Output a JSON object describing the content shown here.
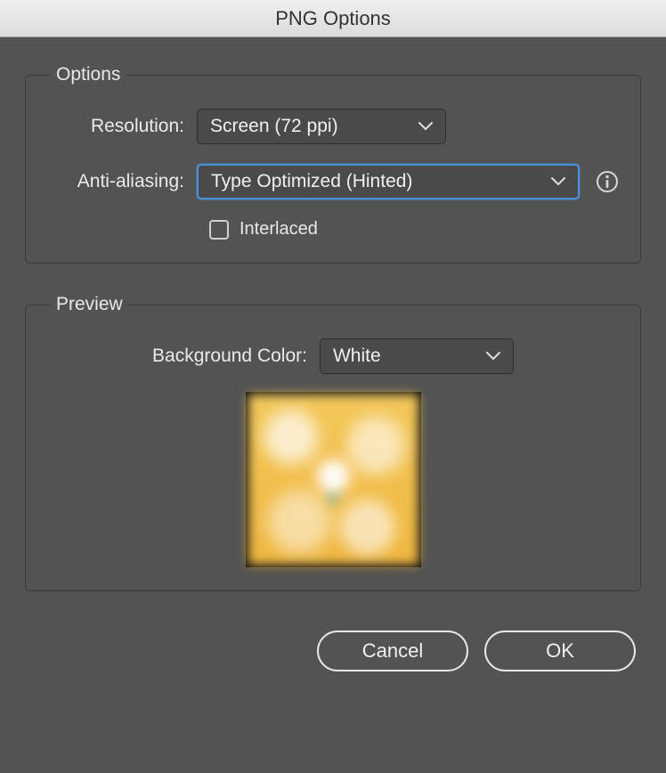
{
  "window": {
    "title": "PNG Options"
  },
  "options": {
    "legend": "Options",
    "resolution_label": "Resolution:",
    "resolution_value": "Screen (72 ppi)",
    "anti_aliasing_label": "Anti-aliasing:",
    "anti_aliasing_value": "Type Optimized (Hinted)",
    "interlaced_label": "Interlaced",
    "interlaced_checked": false
  },
  "preview": {
    "legend": "Preview",
    "background_color_label": "Background Color:",
    "background_color_value": "White"
  },
  "buttons": {
    "cancel": "Cancel",
    "ok": "OK"
  }
}
